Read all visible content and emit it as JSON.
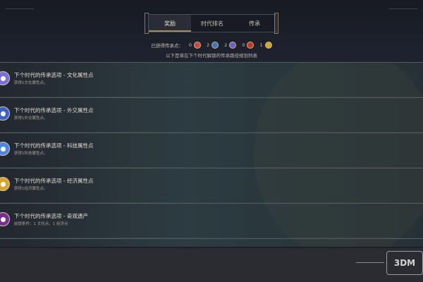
{
  "tabs": [
    {
      "label": "奖励",
      "active": true
    },
    {
      "label": "时代排名",
      "active": false
    },
    {
      "label": "传承",
      "active": false
    }
  ],
  "points": {
    "label": "已获得传承点：",
    "items": [
      {
        "value": "0",
        "icon": "culture-point-icon",
        "color": "#c9483f"
      },
      {
        "value": "2",
        "icon": "diplomacy-point-icon",
        "color": "#3e74c9"
      },
      {
        "value": "2",
        "icon": "science-point-icon",
        "color": "#6a5fd1"
      },
      {
        "value": "0",
        "icon": "military-point-icon",
        "color": "#c0392b"
      },
      {
        "value": "1",
        "icon": "economic-point-icon",
        "color": "#d8a630"
      }
    ]
  },
  "caption": "以下是将在下个时代解锁的传承路径规划列表",
  "rows": [
    {
      "title": "下个时代的传承选项 - 文化属性点",
      "subtitle": "获得1文化属性点。",
      "icon": "culture-attribute-icon",
      "color": "#7a6fd8"
    },
    {
      "title": "下个时代的传承选项 - 外交属性点",
      "subtitle": "获得1外交属性点。",
      "icon": "diplomacy-attribute-icon",
      "color": "#3c63c4"
    },
    {
      "title": "下个时代的传承选项 - 科技属性点",
      "subtitle": "获得1科技属性点。",
      "icon": "science-attribute-icon",
      "color": "#4f86e0"
    },
    {
      "title": "下个时代的传承选项 - 经济属性点",
      "subtitle": "获得1经济属性点。",
      "icon": "economic-attribute-icon",
      "color": "#d9a32e"
    },
    {
      "title": "下个时代的传承选项 - 奇观遗产",
      "subtitle": "前提条件：1 文化点、1 经济点",
      "icon": "wonder-legacy-icon",
      "color": "#7b2d8e"
    }
  ],
  "watermark": "3DM"
}
